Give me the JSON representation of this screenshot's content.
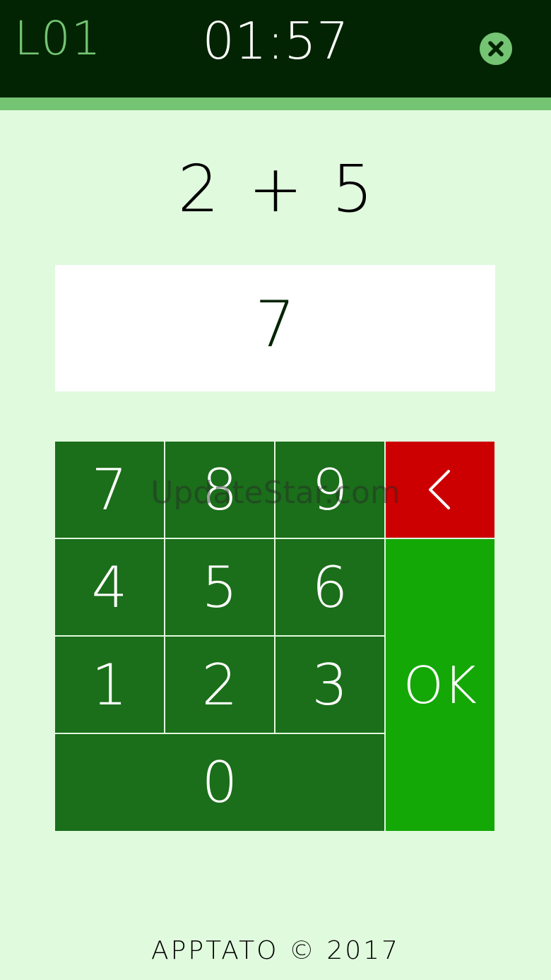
{
  "header": {
    "level": "L01",
    "timer": "01:57",
    "close_icon": "close-icon"
  },
  "question": "2 + 5",
  "answer": "7",
  "keypad": {
    "keys": [
      "7",
      "8",
      "9",
      "4",
      "5",
      "6",
      "1",
      "2",
      "3",
      "0"
    ],
    "backspace_icon": "chevron-left-icon",
    "ok_label": "OK"
  },
  "watermark": "UpdateStar.com",
  "footer": "APPTATO © 2017",
  "colors": {
    "header_bg": "#022402",
    "accent": "#74c473",
    "background": "#e0fadd",
    "key": "#1b6e1a",
    "backspace": "#cc0000",
    "ok": "#14a806"
  }
}
